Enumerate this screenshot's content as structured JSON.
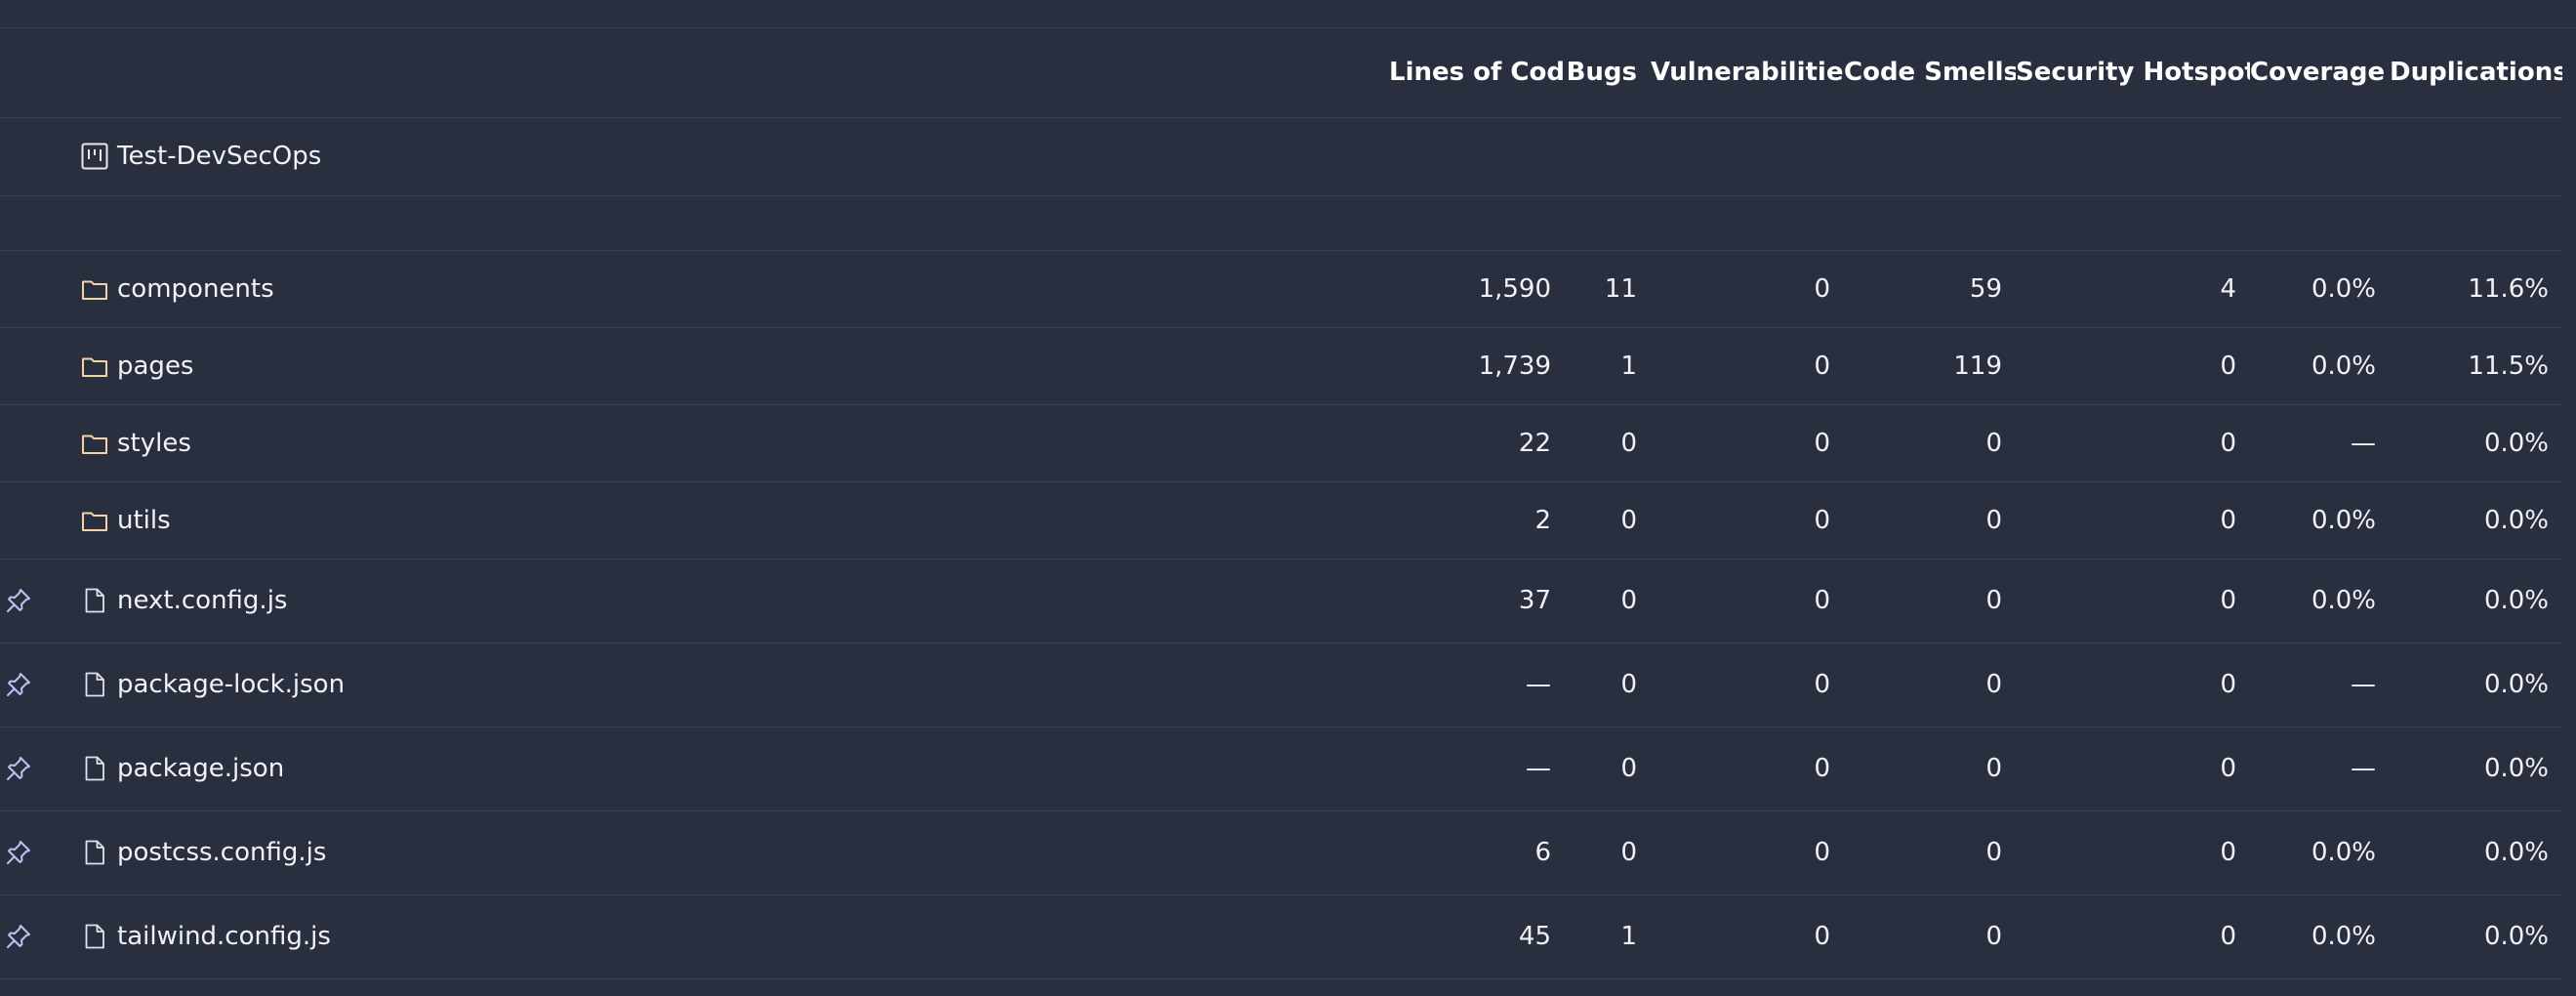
{
  "columns": [
    "Lines of Code",
    "Bugs",
    "Vulnerabilities",
    "Code Smells",
    "Security Hotspots",
    "Coverage",
    "Duplications"
  ],
  "project": {
    "name": "Test-DevSecOps",
    "icon": "project-board-icon"
  },
  "folders": [
    {
      "name": "components",
      "icon": "folder-icon",
      "loc": "1,590",
      "bugs": "11",
      "vulnerabilities": "0",
      "code_smells": "59",
      "hotspots": "4",
      "coverage": "0.0%",
      "duplications": "11.6%"
    },
    {
      "name": "pages",
      "icon": "folder-icon",
      "loc": "1,739",
      "bugs": "1",
      "vulnerabilities": "0",
      "code_smells": "119",
      "hotspots": "0",
      "coverage": "0.0%",
      "duplications": "11.5%"
    },
    {
      "name": "styles",
      "icon": "folder-icon",
      "loc": "22",
      "bugs": "0",
      "vulnerabilities": "0",
      "code_smells": "0",
      "hotspots": "0",
      "coverage": "—",
      "duplications": "0.0%"
    },
    {
      "name": "utils",
      "icon": "folder-icon",
      "loc": "2",
      "bugs": "0",
      "vulnerabilities": "0",
      "code_smells": "0",
      "hotspots": "0",
      "coverage": "0.0%",
      "duplications": "0.0%"
    }
  ],
  "files": [
    {
      "name": "next.config.js",
      "icon": "file-icon",
      "loc": "37",
      "bugs": "0",
      "vulnerabilities": "0",
      "code_smells": "0",
      "hotspots": "0",
      "coverage": "0.0%",
      "duplications": "0.0%"
    },
    {
      "name": "package-lock.json",
      "icon": "file-icon",
      "loc": "—",
      "bugs": "0",
      "vulnerabilities": "0",
      "code_smells": "0",
      "hotspots": "0",
      "coverage": "—",
      "duplications": "0.0%"
    },
    {
      "name": "package.json",
      "icon": "file-icon",
      "loc": "—",
      "bugs": "0",
      "vulnerabilities": "0",
      "code_smells": "0",
      "hotspots": "0",
      "coverage": "—",
      "duplications": "0.0%"
    },
    {
      "name": "postcss.config.js",
      "icon": "file-icon",
      "loc": "6",
      "bugs": "0",
      "vulnerabilities": "0",
      "code_smells": "0",
      "hotspots": "0",
      "coverage": "0.0%",
      "duplications": "0.0%"
    },
    {
      "name": "tailwind.config.js",
      "icon": "file-icon",
      "loc": "45",
      "bugs": "1",
      "vulnerabilities": "0",
      "code_smells": "0",
      "hotspots": "0",
      "coverage": "0.0%",
      "duplications": "0.0%"
    }
  ],
  "colors": {
    "background": "#2a2f40",
    "divider": "#3a4054",
    "folder": "#f3d3a4",
    "pin": "#b9c2f0",
    "text": "#f0f2f6"
  }
}
